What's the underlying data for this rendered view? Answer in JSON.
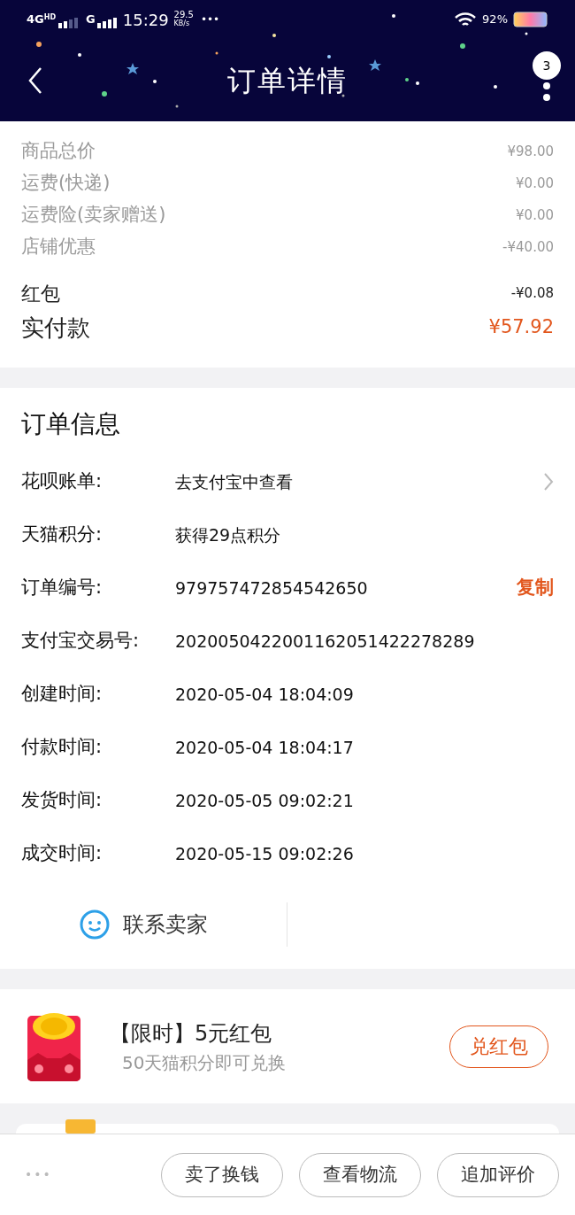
{
  "status_bar": {
    "network_1": "4G",
    "network_1_sup": "HD",
    "network_2": "G",
    "time": "15:29",
    "speed_value": "29.5",
    "speed_unit": "KB/s",
    "more": "•••",
    "battery": "92%"
  },
  "header": {
    "title": "订单详情",
    "badge": "3"
  },
  "price_summary": [
    {
      "label": "商品总价",
      "amount": "¥98.00",
      "kind": "minor"
    },
    {
      "label": "运费(快递)",
      "amount": "¥0.00",
      "kind": "minor"
    },
    {
      "label": "运费险(卖家赠送)",
      "amount": "¥0.00",
      "kind": "minor"
    },
    {
      "label": "店铺优惠",
      "amount": "-¥40.00",
      "kind": "minor"
    },
    {
      "label": "红包",
      "amount": "-¥0.08",
      "kind": "major"
    },
    {
      "label": "实付款",
      "amount": "¥57.92",
      "kind": "total"
    }
  ],
  "order_info": {
    "title": "订单信息",
    "rows": [
      {
        "label": "花呗账单:",
        "value": "去支付宝中查看",
        "kind": "link"
      },
      {
        "label": "天猫积分:",
        "value": "获得29点积分",
        "kind": "plain"
      },
      {
        "label": "订单编号:",
        "value": "979757472854542650",
        "kind": "copy",
        "action": "复制"
      },
      {
        "label": "支付宝交易号:",
        "value": "2020050422001162051422278289",
        "kind": "plain"
      },
      {
        "label": "创建时间:",
        "value": "2020-05-04 18:04:09",
        "kind": "plain"
      },
      {
        "label": "付款时间:",
        "value": "2020-05-04 18:04:17",
        "kind": "plain"
      },
      {
        "label": "发货时间:",
        "value": "2020-05-05 09:02:21",
        "kind": "plain"
      },
      {
        "label": "成交时间:",
        "value": "2020-05-15 09:02:26",
        "kind": "plain"
      }
    ],
    "contact_button": "联系卖家"
  },
  "coupon": {
    "title": "【限时】5元红包",
    "subtitle": "50天猫积分即可兑换",
    "button": "兑红包"
  },
  "bottom_bar": {
    "more": "•••",
    "buttons": [
      "卖了换钱",
      "查看物流",
      "追加评价"
    ]
  }
}
